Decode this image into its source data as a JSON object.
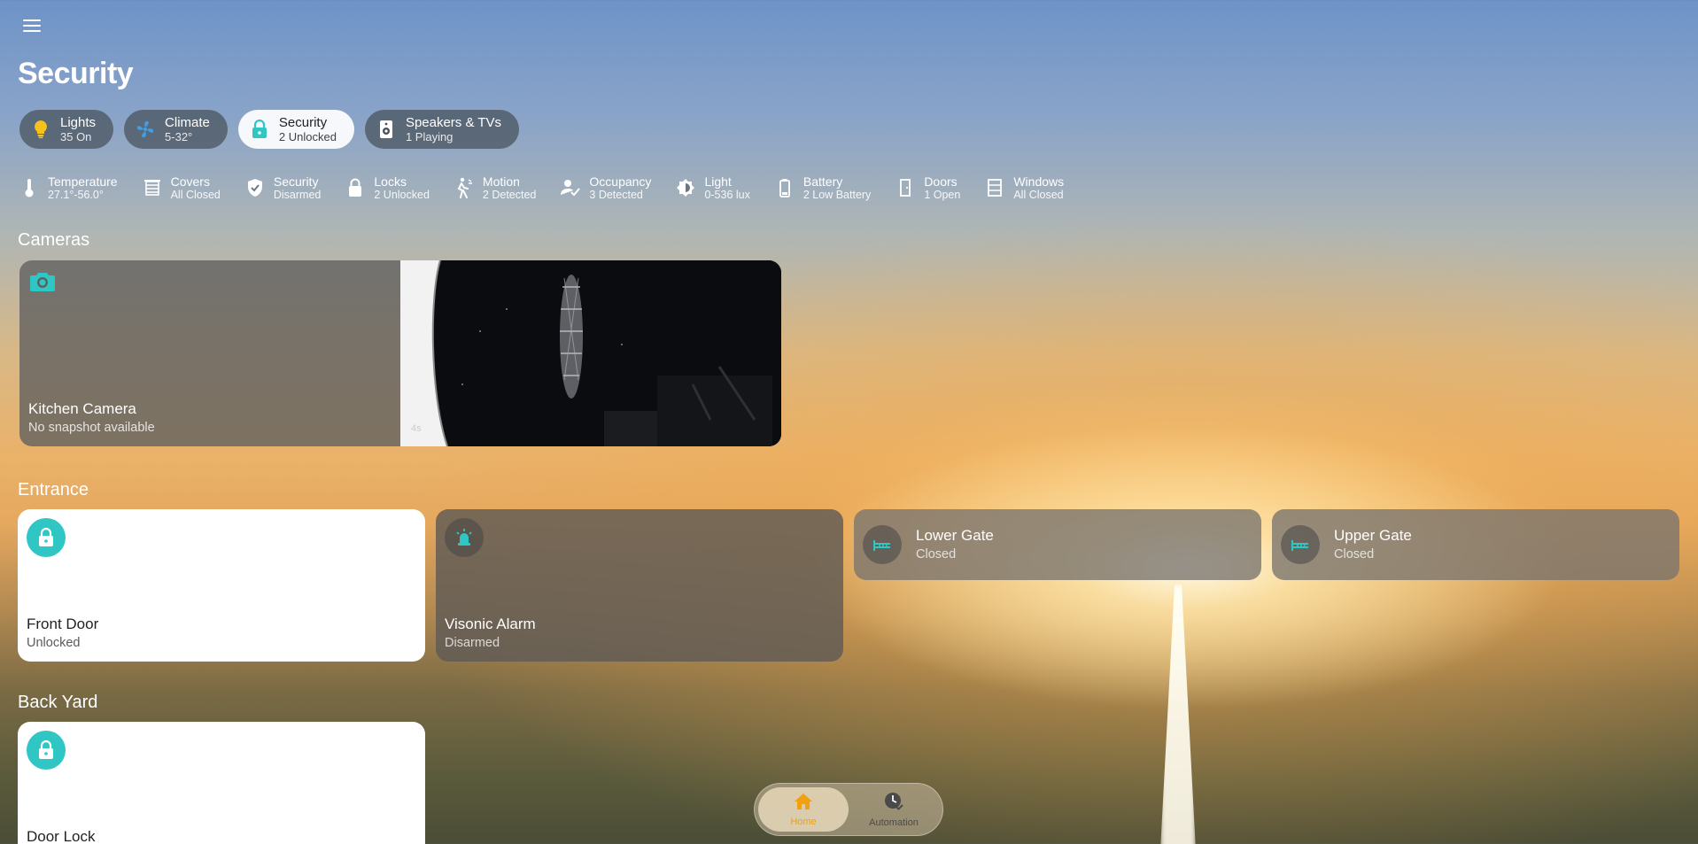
{
  "page": {
    "title": "Security"
  },
  "colors": {
    "accent": "#2fc6c4",
    "home_active": "#f0a010",
    "lights_icon": "#f7c21c",
    "climate_icon": "#3fa0e8"
  },
  "chips": [
    {
      "icon": "bulb-icon",
      "label": "Lights",
      "state": "35 On"
    },
    {
      "icon": "fan-icon",
      "label": "Climate",
      "state": "5-32°"
    },
    {
      "icon": "lock-icon",
      "label": "Security",
      "state": "2 Unlocked"
    },
    {
      "icon": "speaker-icon",
      "label": "Speakers & TVs",
      "state": "1 Playing"
    }
  ],
  "badges": [
    {
      "icon": "thermometer-icon",
      "label": "Temperature",
      "state": "27.1°-56.0°"
    },
    {
      "icon": "blinds-icon",
      "label": "Covers",
      "state": "All Closed"
    },
    {
      "icon": "shield-check-icon",
      "label": "Security",
      "state": "Disarmed"
    },
    {
      "icon": "lock-icon",
      "label": "Locks",
      "state": "2 Unlocked"
    },
    {
      "icon": "motion-icon",
      "label": "Motion",
      "state": "2 Detected"
    },
    {
      "icon": "occupancy-icon",
      "label": "Occupancy",
      "state": "3 Detected"
    },
    {
      "icon": "brightness-icon",
      "label": "Light",
      "state": "0-536 lux"
    },
    {
      "icon": "battery-icon",
      "label": "Battery",
      "state": "2 Low Battery"
    },
    {
      "icon": "door-icon",
      "label": "Doors",
      "state": "1 Open"
    },
    {
      "icon": "window-icon",
      "label": "Windows",
      "state": "All Closed"
    }
  ],
  "sections": {
    "cameras": "Cameras",
    "entrance": "Entrance",
    "backyard": "Back Yard"
  },
  "cameras": {
    "kitchen": {
      "name": "Kitchen Camera",
      "state": "No snapshot available"
    },
    "feed": {
      "age": "4s"
    }
  },
  "entrance": {
    "front_door": {
      "name": "Front Door",
      "state": "Unlocked"
    },
    "alarm": {
      "name": "Visonic Alarm",
      "state": "Disarmed"
    },
    "lower_gate": {
      "name": "Lower Gate",
      "state": "Closed"
    },
    "upper_gate": {
      "name": "Upper Gate",
      "state": "Closed"
    }
  },
  "backyard": {
    "door_lock": {
      "name": "Door Lock"
    }
  },
  "nav": {
    "home": "Home",
    "automation": "Automation"
  }
}
